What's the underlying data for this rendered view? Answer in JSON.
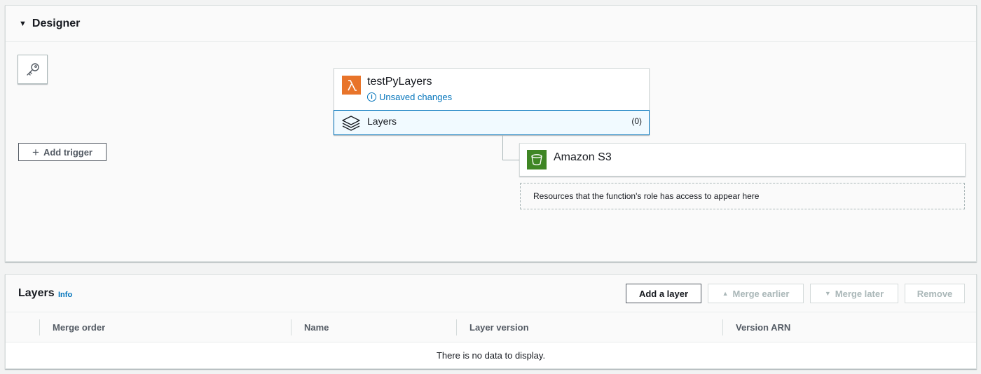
{
  "designer": {
    "title": "Designer",
    "add_trigger_label": "Add trigger",
    "function": {
      "name": "testPyLayers",
      "status": "Unsaved changes",
      "layers_label": "Layers",
      "layers_count": "(0)"
    },
    "resource": {
      "name": "Amazon S3",
      "placeholder": "Resources that the function's role has access to appear here"
    }
  },
  "layers_panel": {
    "title": "Layers",
    "info_link": "Info",
    "buttons": {
      "add": "Add a layer",
      "merge_earlier": "Merge earlier",
      "merge_later": "Merge later",
      "remove": "Remove"
    },
    "columns": [
      "Merge order",
      "Name",
      "Layer version",
      "Version ARN"
    ],
    "empty_message": "There is no data to display."
  },
  "colors": {
    "lambda": "#e8742a",
    "s3": "#3f8624",
    "link": "#0073bb",
    "selected_bg": "#f1faff"
  }
}
